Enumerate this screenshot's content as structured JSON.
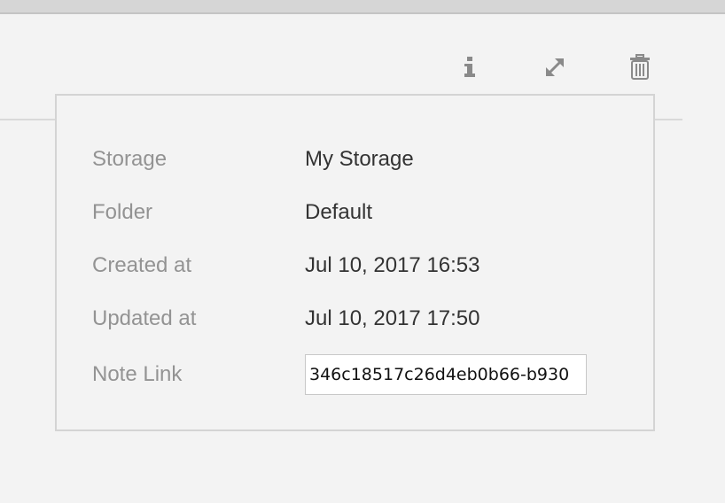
{
  "toolbar": {
    "info_icon": "info-icon",
    "expand_icon": "expand-icon",
    "trash_icon": "trash-icon"
  },
  "info_panel": {
    "rows": [
      {
        "label": "Storage",
        "value": "My Storage"
      },
      {
        "label": "Folder",
        "value": "Default"
      },
      {
        "label": "Created at",
        "value": "Jul 10, 2017 16:53"
      },
      {
        "label": "Updated at",
        "value": "Jul 10, 2017 17:50"
      }
    ],
    "note_link": {
      "label": "Note Link",
      "value": "346c18517c26d4eb0b66-b930"
    }
  },
  "colors": {
    "background": "#f3f3f3",
    "label": "#939393",
    "value": "#333333",
    "icon": "#8a8a8a",
    "border": "#d4d4d4"
  }
}
